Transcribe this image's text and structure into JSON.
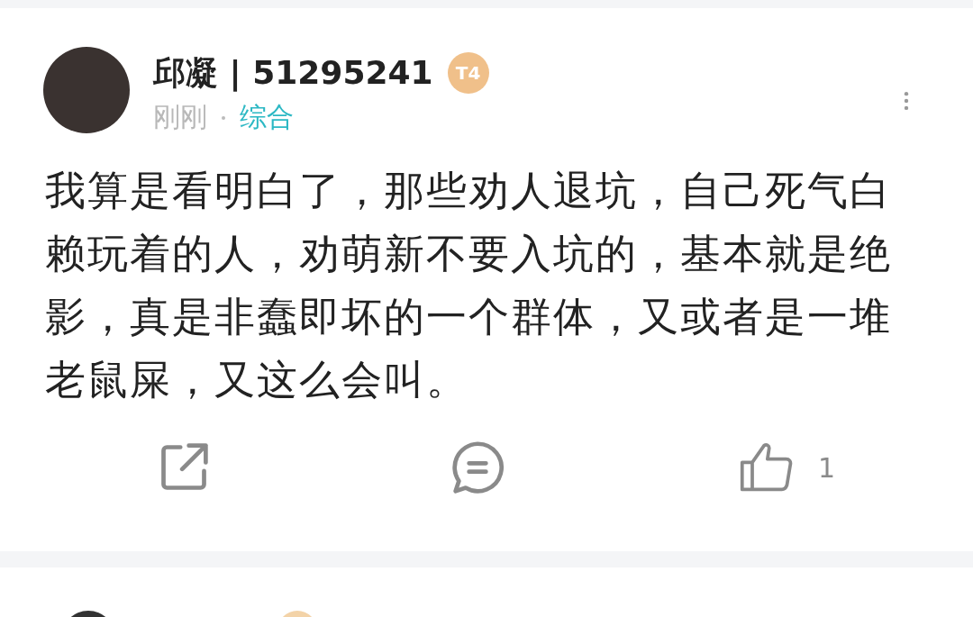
{
  "post": {
    "author": "邱凝 | 51295241",
    "badge": "T4",
    "time": "刚刚",
    "category": "综合",
    "body": "我算是看明白了，那些劝人退坑，自己死气白赖玩着的人，劝萌新不要入坑的，基本就是绝影，真是非蠢即坏的一个群体，又或者是一堆老鼠屎，又这么会叫。",
    "likes": "1"
  }
}
